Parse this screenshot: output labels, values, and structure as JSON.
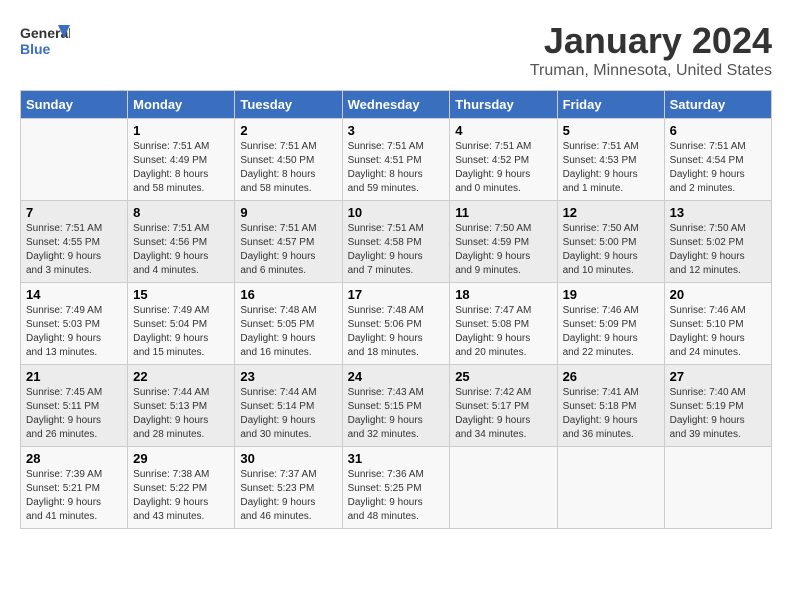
{
  "header": {
    "logo_text_general": "General",
    "logo_text_blue": "Blue",
    "month_title": "January 2024",
    "location": "Truman, Minnesota, United States"
  },
  "weekdays": [
    "Sunday",
    "Monday",
    "Tuesday",
    "Wednesday",
    "Thursday",
    "Friday",
    "Saturday"
  ],
  "weeks": [
    [
      {
        "day": "",
        "info": ""
      },
      {
        "day": "1",
        "info": "Sunrise: 7:51 AM\nSunset: 4:49 PM\nDaylight: 8 hours\nand 58 minutes."
      },
      {
        "day": "2",
        "info": "Sunrise: 7:51 AM\nSunset: 4:50 PM\nDaylight: 8 hours\nand 58 minutes."
      },
      {
        "day": "3",
        "info": "Sunrise: 7:51 AM\nSunset: 4:51 PM\nDaylight: 8 hours\nand 59 minutes."
      },
      {
        "day": "4",
        "info": "Sunrise: 7:51 AM\nSunset: 4:52 PM\nDaylight: 9 hours\nand 0 minutes."
      },
      {
        "day": "5",
        "info": "Sunrise: 7:51 AM\nSunset: 4:53 PM\nDaylight: 9 hours\nand 1 minute."
      },
      {
        "day": "6",
        "info": "Sunrise: 7:51 AM\nSunset: 4:54 PM\nDaylight: 9 hours\nand 2 minutes."
      }
    ],
    [
      {
        "day": "7",
        "info": "Sunrise: 7:51 AM\nSunset: 4:55 PM\nDaylight: 9 hours\nand 3 minutes."
      },
      {
        "day": "8",
        "info": "Sunrise: 7:51 AM\nSunset: 4:56 PM\nDaylight: 9 hours\nand 4 minutes."
      },
      {
        "day": "9",
        "info": "Sunrise: 7:51 AM\nSunset: 4:57 PM\nDaylight: 9 hours\nand 6 minutes."
      },
      {
        "day": "10",
        "info": "Sunrise: 7:51 AM\nSunset: 4:58 PM\nDaylight: 9 hours\nand 7 minutes."
      },
      {
        "day": "11",
        "info": "Sunrise: 7:50 AM\nSunset: 4:59 PM\nDaylight: 9 hours\nand 9 minutes."
      },
      {
        "day": "12",
        "info": "Sunrise: 7:50 AM\nSunset: 5:00 PM\nDaylight: 9 hours\nand 10 minutes."
      },
      {
        "day": "13",
        "info": "Sunrise: 7:50 AM\nSunset: 5:02 PM\nDaylight: 9 hours\nand 12 minutes."
      }
    ],
    [
      {
        "day": "14",
        "info": "Sunrise: 7:49 AM\nSunset: 5:03 PM\nDaylight: 9 hours\nand 13 minutes."
      },
      {
        "day": "15",
        "info": "Sunrise: 7:49 AM\nSunset: 5:04 PM\nDaylight: 9 hours\nand 15 minutes."
      },
      {
        "day": "16",
        "info": "Sunrise: 7:48 AM\nSunset: 5:05 PM\nDaylight: 9 hours\nand 16 minutes."
      },
      {
        "day": "17",
        "info": "Sunrise: 7:48 AM\nSunset: 5:06 PM\nDaylight: 9 hours\nand 18 minutes."
      },
      {
        "day": "18",
        "info": "Sunrise: 7:47 AM\nSunset: 5:08 PM\nDaylight: 9 hours\nand 20 minutes."
      },
      {
        "day": "19",
        "info": "Sunrise: 7:46 AM\nSunset: 5:09 PM\nDaylight: 9 hours\nand 22 minutes."
      },
      {
        "day": "20",
        "info": "Sunrise: 7:46 AM\nSunset: 5:10 PM\nDaylight: 9 hours\nand 24 minutes."
      }
    ],
    [
      {
        "day": "21",
        "info": "Sunrise: 7:45 AM\nSunset: 5:11 PM\nDaylight: 9 hours\nand 26 minutes."
      },
      {
        "day": "22",
        "info": "Sunrise: 7:44 AM\nSunset: 5:13 PM\nDaylight: 9 hours\nand 28 minutes."
      },
      {
        "day": "23",
        "info": "Sunrise: 7:44 AM\nSunset: 5:14 PM\nDaylight: 9 hours\nand 30 minutes."
      },
      {
        "day": "24",
        "info": "Sunrise: 7:43 AM\nSunset: 5:15 PM\nDaylight: 9 hours\nand 32 minutes."
      },
      {
        "day": "25",
        "info": "Sunrise: 7:42 AM\nSunset: 5:17 PM\nDaylight: 9 hours\nand 34 minutes."
      },
      {
        "day": "26",
        "info": "Sunrise: 7:41 AM\nSunset: 5:18 PM\nDaylight: 9 hours\nand 36 minutes."
      },
      {
        "day": "27",
        "info": "Sunrise: 7:40 AM\nSunset: 5:19 PM\nDaylight: 9 hours\nand 39 minutes."
      }
    ],
    [
      {
        "day": "28",
        "info": "Sunrise: 7:39 AM\nSunset: 5:21 PM\nDaylight: 9 hours\nand 41 minutes."
      },
      {
        "day": "29",
        "info": "Sunrise: 7:38 AM\nSunset: 5:22 PM\nDaylight: 9 hours\nand 43 minutes."
      },
      {
        "day": "30",
        "info": "Sunrise: 7:37 AM\nSunset: 5:23 PM\nDaylight: 9 hours\nand 46 minutes."
      },
      {
        "day": "31",
        "info": "Sunrise: 7:36 AM\nSunset: 5:25 PM\nDaylight: 9 hours\nand 48 minutes."
      },
      {
        "day": "",
        "info": ""
      },
      {
        "day": "",
        "info": ""
      },
      {
        "day": "",
        "info": ""
      }
    ]
  ]
}
